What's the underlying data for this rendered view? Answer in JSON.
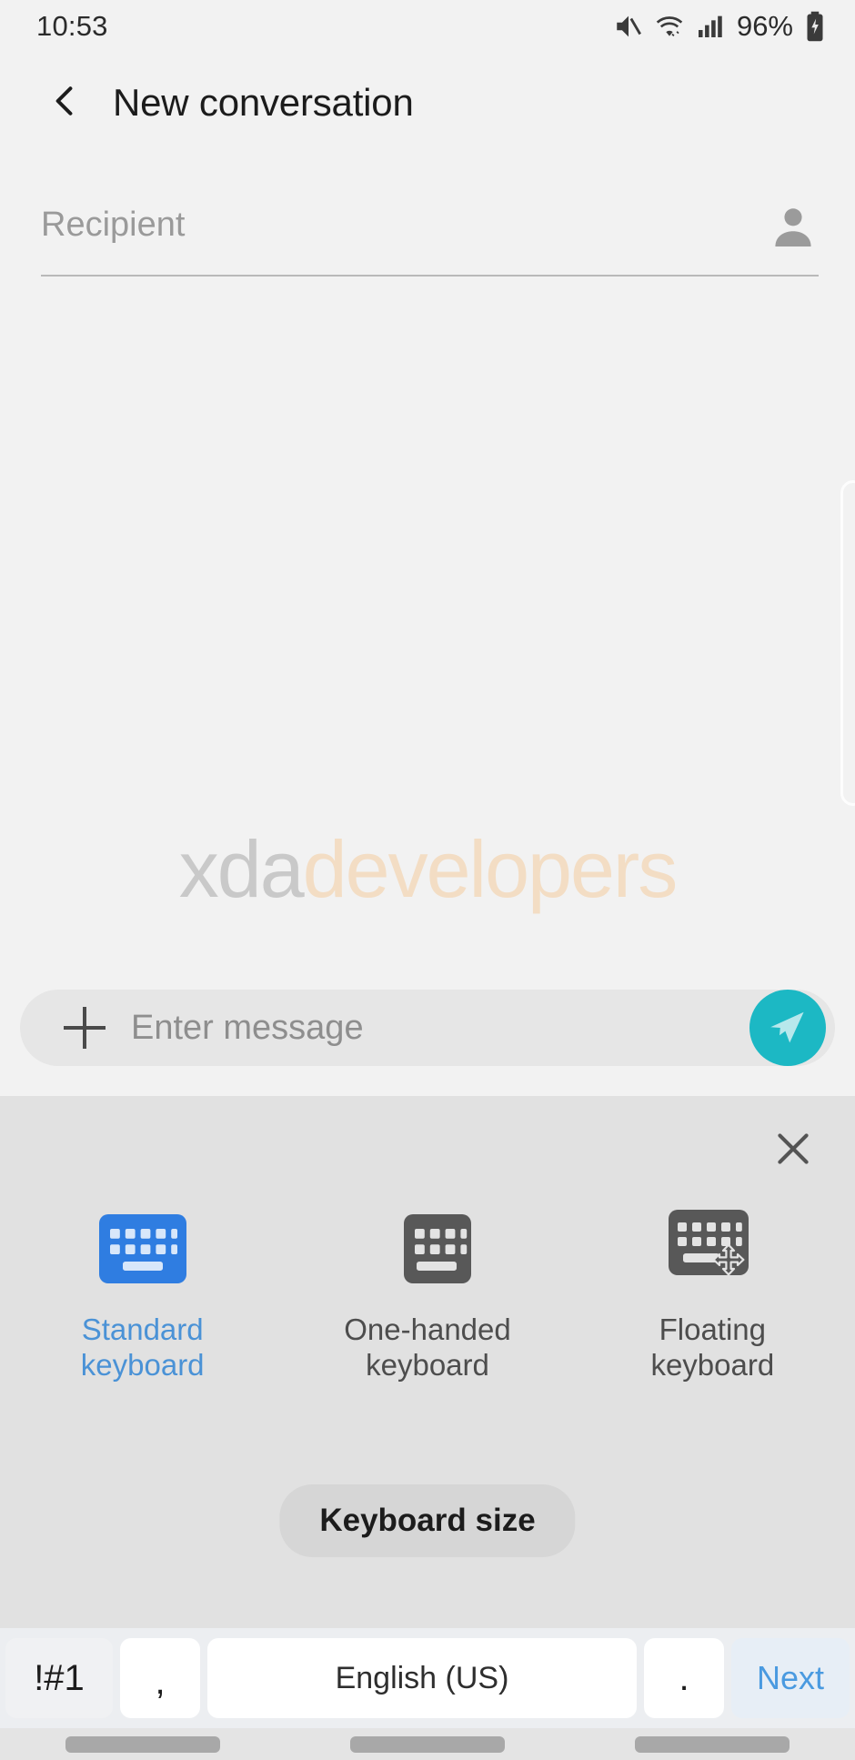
{
  "status_bar": {
    "time": "10:53",
    "battery_percent": "96%",
    "icons": [
      "mute-icon",
      "wifi-icon",
      "signal-icon",
      "battery-charging-icon"
    ]
  },
  "app_bar": {
    "back_icon": "chevron-left-icon",
    "title": "New conversation"
  },
  "recipient": {
    "placeholder": "Recipient",
    "contact_icon": "contact-person-icon"
  },
  "watermark": {
    "part1": "xda",
    "part2": "developers",
    "color1": "#c9c9c9",
    "color2": "#f3ddc4"
  },
  "message_bar": {
    "add_icon": "plus-icon",
    "placeholder": "Enter message",
    "send_icon": "send-paper-plane-icon",
    "send_color": "#1cb8c4"
  },
  "keyboard_panel": {
    "close_icon": "close-icon",
    "modes": [
      {
        "label": "Standard\nkeyboard",
        "icon": "standard-keyboard-icon",
        "selected": true
      },
      {
        "label": "One-handed\nkeyboard",
        "icon": "one-handed-keyboard-icon",
        "selected": false
      },
      {
        "label": "Floating\nkeyboard",
        "icon": "floating-keyboard-icon",
        "selected": false
      }
    ],
    "selected_color": "#4a92d6",
    "size_button": "Keyboard size"
  },
  "keyboard_row": {
    "symbols_key": "!#1",
    "comma_key": ",",
    "space_key": "English (US)",
    "period_key": ".",
    "next_key": "Next",
    "next_color": "#4a9ae0"
  },
  "nav_bar": {
    "buttons": [
      "recents-button",
      "home-button",
      "back-button"
    ]
  }
}
